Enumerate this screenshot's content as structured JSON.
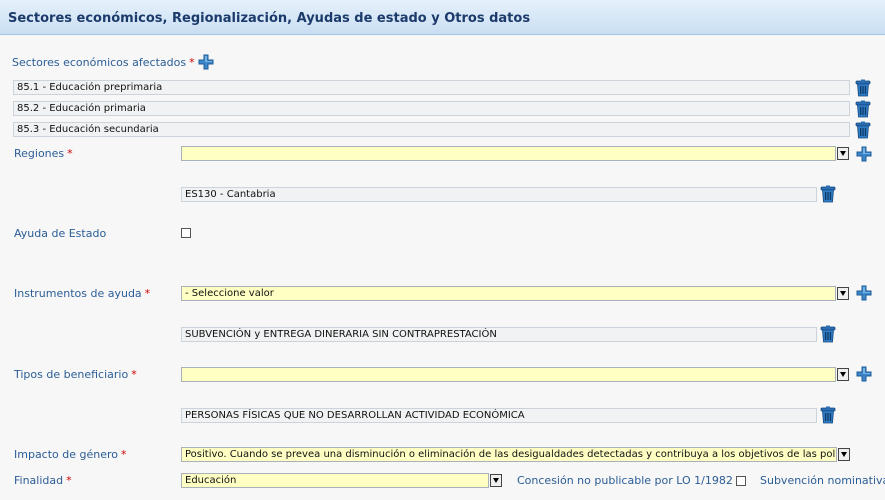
{
  "header": {
    "title": "Sectores económicos, Regionalización, Ayudas de estado y Otros datos"
  },
  "sectores": {
    "label": "Sectores económicos afectados",
    "required": "*",
    "items": [
      "85.1 - Educación preprimaria",
      "85.2 - Educación primaria",
      "85.3 - Educación secundaria"
    ]
  },
  "regiones": {
    "label": "Regiones",
    "required": "*",
    "select_value": "",
    "items": [
      "ES130 - Cantabria"
    ]
  },
  "ayuda_estado": {
    "label": "Ayuda de Estado",
    "checked": false
  },
  "instrumentos": {
    "label": "Instrumentos de ayuda",
    "required": "*",
    "select_value": "- Seleccione valor",
    "items": [
      "SUBVENCIÓN y ENTREGA DINERARIA SIN CONTRAPRESTACIÓN"
    ]
  },
  "beneficiarios": {
    "label": "Tipos de beneficiario",
    "required": "*",
    "select_value": "",
    "items": [
      "PERSONAS FÍSICAS QUE NO DESARROLLAN ACTIVIDAD ECONÓMICA"
    ]
  },
  "impacto": {
    "label": "Impacto de género",
    "required": "*",
    "select_value": "Positivo. Cuando se prevea una disminución o eliminación de las desigualdades detectadas y contribuya a los objetivos de las política..."
  },
  "finalidad": {
    "label": "Finalidad",
    "required": "*",
    "select_value": "Educación"
  },
  "concesion": {
    "label": "Concesión no publicable por LO 1/1982",
    "checked": false
  },
  "subvencion_nominativa": {
    "label": "Subvención nominativa"
  },
  "icons": {
    "add": "plus-icon",
    "delete": "trash-icon",
    "accent": "#2b6fb5"
  }
}
